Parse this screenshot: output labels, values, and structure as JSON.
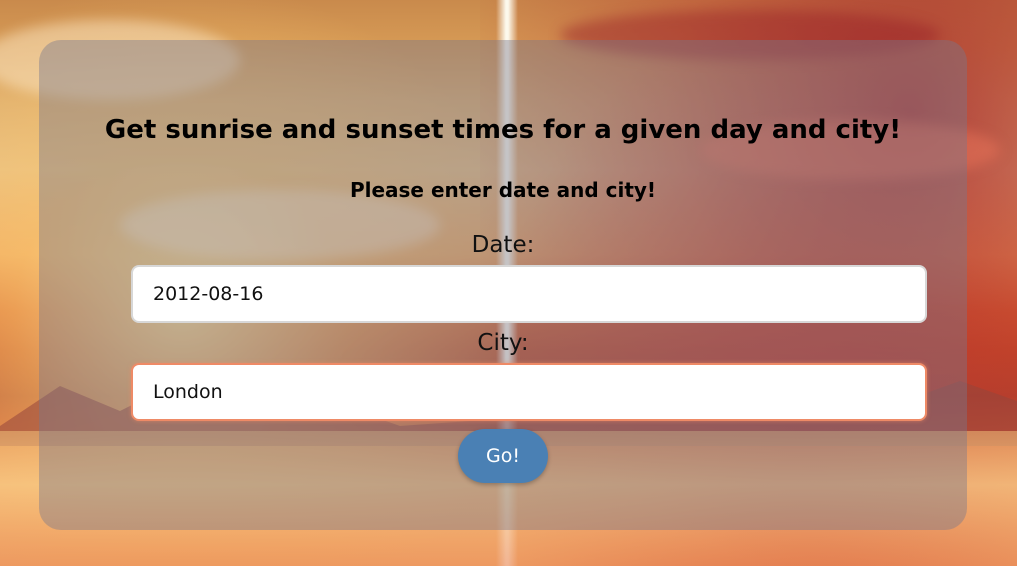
{
  "page": {
    "title": "Get sunrise and sunset times for a given day and city!",
    "subtitle": "Please enter date and city!"
  },
  "form": {
    "date_label": "Date:",
    "date_value": "2012-08-16",
    "city_label": "City:",
    "city_value": "London",
    "submit_label": "Go!"
  },
  "colors": {
    "button": "#4a80b4",
    "focused_input_border": "#ee8a66",
    "panel_overlay": "rgba(120,120,140,0.42)"
  }
}
